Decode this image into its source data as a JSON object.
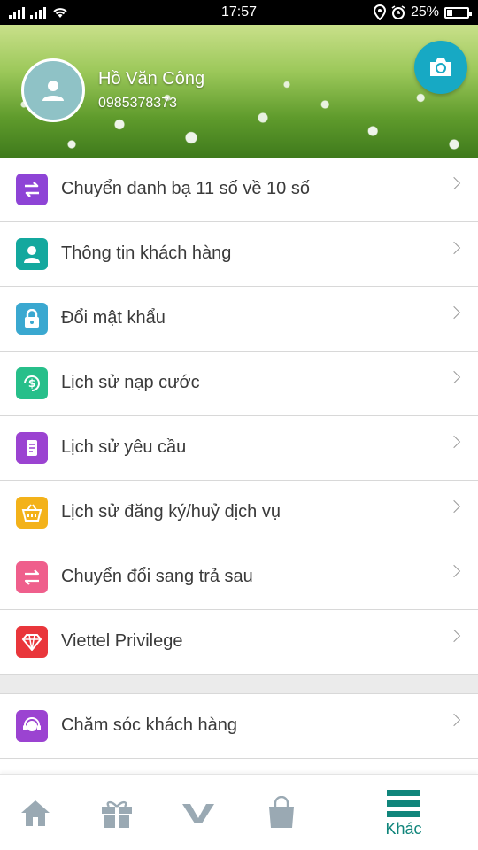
{
  "status_bar": {
    "time": "17:57",
    "battery": "25%",
    "icons": [
      "signal-icon",
      "wifi-icon",
      "location-icon",
      "alarm-icon",
      "battery-icon"
    ]
  },
  "profile": {
    "name": "Hồ Văn Công",
    "phone": "0985378373"
  },
  "colors": {
    "accent": "#17a9c4",
    "nav_active": "#10857b",
    "nav_inactive": "#9aa9b3"
  },
  "menu": {
    "items": [
      {
        "label": "Chuyển danh bạ 11 số về 10 số",
        "icon": "swap-arrows-icon",
        "color": "#8e44d6"
      },
      {
        "label": "Thông tin khách hàng",
        "icon": "user-icon",
        "color": "#13a89e"
      },
      {
        "label": "Đổi mật khẩu",
        "icon": "lock-icon",
        "color": "#3aa8d0"
      },
      {
        "label": "Lịch sử nạp cước",
        "icon": "dollar-refresh-icon",
        "color": "#27bf8a"
      },
      {
        "label": "Lịch sử yêu cầu",
        "icon": "scroll-icon",
        "color": "#9b43d1"
      },
      {
        "label": "Lịch sử đăng ký/huỷ dịch vụ",
        "icon": "basket-icon",
        "color": "#f3b21a"
      },
      {
        "label": "Chuyển đổi sang trả sau",
        "icon": "exchange-icon",
        "color": "#ef5f8c"
      },
      {
        "label": "Viettel Privilege",
        "icon": "diamond-icon",
        "color": "#e9363b"
      }
    ],
    "care_item": {
      "label": "Chăm sóc khách hàng",
      "icon": "support-agent-icon",
      "color": "#9b43d1"
    }
  },
  "bottom_nav": {
    "items": [
      {
        "icon": "home-icon"
      },
      {
        "icon": "gift-icon"
      },
      {
        "icon": "viettel-logo-icon"
      },
      {
        "icon": "shopping-bag-icon"
      },
      {
        "icon": "menu-icon",
        "label": "Khác",
        "active": true
      }
    ]
  }
}
